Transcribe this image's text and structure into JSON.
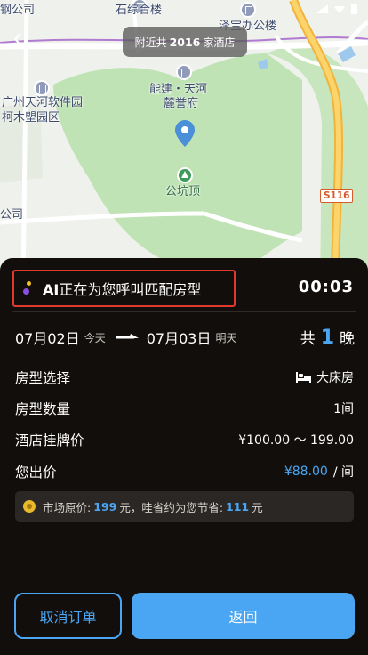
{
  "map": {
    "labels": {
      "top_left": "钢公司",
      "shizonghe": "石综合楼",
      "zebao": "泽宝办公楼",
      "software_park": "广州天河软件园",
      "kemu": "柯木塱园区",
      "nengjian_1": "能建・天河",
      "nengjian_2": "麓誉府",
      "gongkeng": "公坑顶",
      "company": "公司"
    },
    "road_badge": "S116",
    "nearby": {
      "prefix": "附近共",
      "count": "2016",
      "suffix": "家酒店"
    }
  },
  "sheet": {
    "status_prefix": "AI",
    "status_text": "正在为您呼叫匹配房型",
    "timer": "00:03",
    "checkin_date": "07月02日",
    "checkin_sub": "今天",
    "checkout_date": "07月03日",
    "checkout_sub": "明天",
    "nights_prefix": "共",
    "nights_count": "1",
    "nights_suffix": "晚",
    "rows": {
      "room_type_label": "房型选择",
      "room_type_value": "大床房",
      "room_count_label": "房型数量",
      "room_count_value": "1间",
      "listed_price_label": "酒店挂牌价",
      "listed_price_value": "¥100.00 ～ 199.00",
      "offer_label": "您出价",
      "offer_value": "¥88.00",
      "offer_unit": "/ 间"
    },
    "savings": {
      "market_label": "市场原价:",
      "market_value": "199",
      "middle": "元，哇省约为您节省:",
      "saved_value": "111",
      "unit": "元"
    },
    "buttons": {
      "cancel": "取消订单",
      "back": "返回"
    }
  },
  "colors": {
    "accent": "#4aa6f2",
    "highlight_border": "#e2392e",
    "sheet_bg": "#120e0b"
  }
}
